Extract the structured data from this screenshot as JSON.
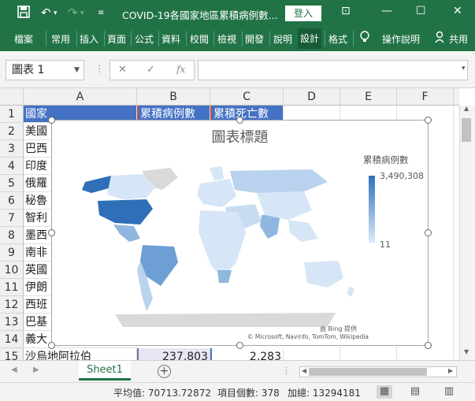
{
  "titlebar": {
    "document_title": "COVID-19各國家地區累積病例數...",
    "login_label": "登入",
    "save_icon": "save-icon",
    "undo_icon": "undo-icon",
    "redo_icon": "redo-icon"
  },
  "ribbon": {
    "tabs": [
      "檔案",
      "常用",
      "插入",
      "頁面",
      "公式",
      "資料",
      "校閱",
      "檢視",
      "開發",
      "說明",
      "設計",
      "格式"
    ],
    "help_label": "操作說明",
    "share_label": "共用"
  },
  "formula_bar": {
    "name_box": "圖表 1",
    "cancel_glyph": "✕",
    "enter_glyph": "✓",
    "fx_glyph": "fx",
    "formula": ""
  },
  "grid": {
    "columns": [
      "A",
      "B",
      "C",
      "D",
      "E",
      "F"
    ],
    "rows": [
      "1",
      "2",
      "3",
      "4",
      "5",
      "6",
      "7",
      "8",
      "9",
      "10",
      "11",
      "12",
      "13",
      "14",
      "15"
    ],
    "header_row": [
      "國家",
      "累積病例數",
      "累積死亡數"
    ],
    "countries": [
      "美國",
      "巴西",
      "印度",
      "俄羅",
      "秘魯",
      "智利",
      "墨西",
      "南非",
      "英國",
      "伊朗",
      "西班",
      "巴基",
      "義大",
      "沙烏地阿拉伯"
    ],
    "row15_b": "237,803",
    "row15_c": "2,283"
  },
  "chart": {
    "title": "圖表標題",
    "legend_title": "累積病例數",
    "legend_max": "3,490,308",
    "legend_min": "11",
    "bing_text": "由 Bing 提供",
    "credits": "© Microsoft, Navinfo, TomTom, Wikipedia",
    "colors": {
      "high": "#2e6fb8",
      "mid": "#8fb7e0",
      "low": "#d6e6f6",
      "none": "#d9d9d9"
    }
  },
  "sheets": {
    "active": "Sheet1",
    "add_glyph": "+"
  },
  "statusbar": {
    "average": "平均值: 70713.72872",
    "count": "項目個數: 378",
    "sum": "加總: 13294181"
  }
}
